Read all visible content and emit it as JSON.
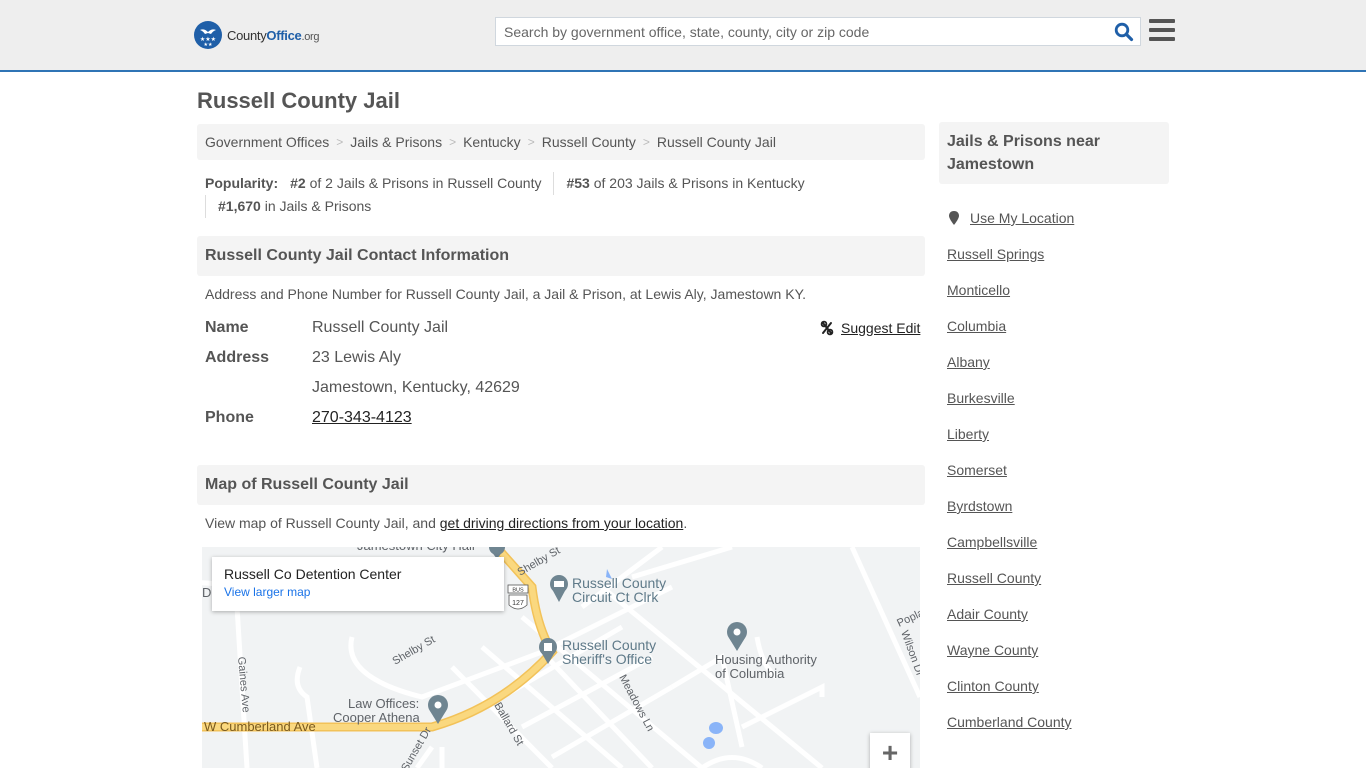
{
  "header": {
    "logo": {
      "brand_plain": "County",
      "brand_bold": "Office",
      "brand_suffix": ".org"
    },
    "search": {
      "placeholder": "Search by government office, state, county, city or zip code",
      "value": ""
    },
    "icons": {
      "search": "search-icon",
      "menu": "hamburger-menu-icon"
    }
  },
  "page": {
    "title": "Russell County Jail"
  },
  "breadcrumb": [
    {
      "label": "Government Offices"
    },
    {
      "label": "Jails & Prisons"
    },
    {
      "label": "Kentucky"
    },
    {
      "label": "Russell County"
    },
    {
      "label": "Russell County Jail"
    }
  ],
  "popularity": {
    "label": "Popularity:",
    "items": [
      {
        "rank": "#2",
        "text": " of 2 Jails & Prisons in Russell County"
      },
      {
        "rank": "#53",
        "text": " of 203 Jails & Prisons in Kentucky"
      },
      {
        "rank": "#1,670",
        "text": " in Jails & Prisons"
      }
    ]
  },
  "contact": {
    "heading": "Russell County Jail Contact Information",
    "description": "Address and Phone Number for Russell County Jail, a Jail & Prison, at Lewis Aly, Jamestown KY.",
    "suggest_edit": "Suggest Edit",
    "name_label": "Name",
    "name_value": "Russell County Jail",
    "address_label": "Address",
    "address_line1": "23 Lewis Aly",
    "address_line2": "Jamestown, Kentucky, 42629",
    "phone_label": "Phone",
    "phone_value": "270-343-4123"
  },
  "map_section": {
    "heading": "Map of Russell County Jail",
    "desc_prefix": "View map of Russell County Jail, and ",
    "desc_link": "get driving directions from your location",
    "desc_suffix": ".",
    "card_title": "Russell Co Detention Center",
    "card_link": "View larger map",
    "zoom_in": "+",
    "labels": {
      "city_hall": "Jamestown City Hall",
      "shelby_st_1": "Shelby St",
      "shelby_st_2": "Shelby St",
      "circuit_1": "Russell County",
      "circuit_2": "Circuit Ct Clrk",
      "sheriff_1": "Russell County",
      "sheriff_2": "Sheriff's Office",
      "housing_1": "Housing Authority",
      "housing_2": "of Columbia",
      "law_1": "Law Offices:",
      "law_2": "Cooper Athena",
      "cumberland": "W Cumberland Ave",
      "gaines": "Gaines Ave",
      "ballard": "Ballard St",
      "meadows": "Meadows Ln",
      "sunset": "Sunset Dr",
      "wilson": "Wilson Dr",
      "poplar": "Poplar",
      "bus": "BUS",
      "route": "127",
      "left_d": "D"
    }
  },
  "sidebar": {
    "heading": "Jails & Prisons near Jamestown",
    "use_location": "Use My Location",
    "links": [
      "Russell Springs",
      "Monticello",
      "Columbia",
      "Albany",
      "Burkesville",
      "Liberty",
      "Somerset",
      "Byrdstown",
      "Campbellsville",
      "Russell County",
      "Adair County",
      "Wayne County",
      "Clinton County",
      "Cumberland County"
    ]
  },
  "colors": {
    "accent_blue": "#2f74b5",
    "logo_blue": "#1f5fa8",
    "road_yellow": "#f7d37a",
    "link_blue": "#1a73e8"
  }
}
